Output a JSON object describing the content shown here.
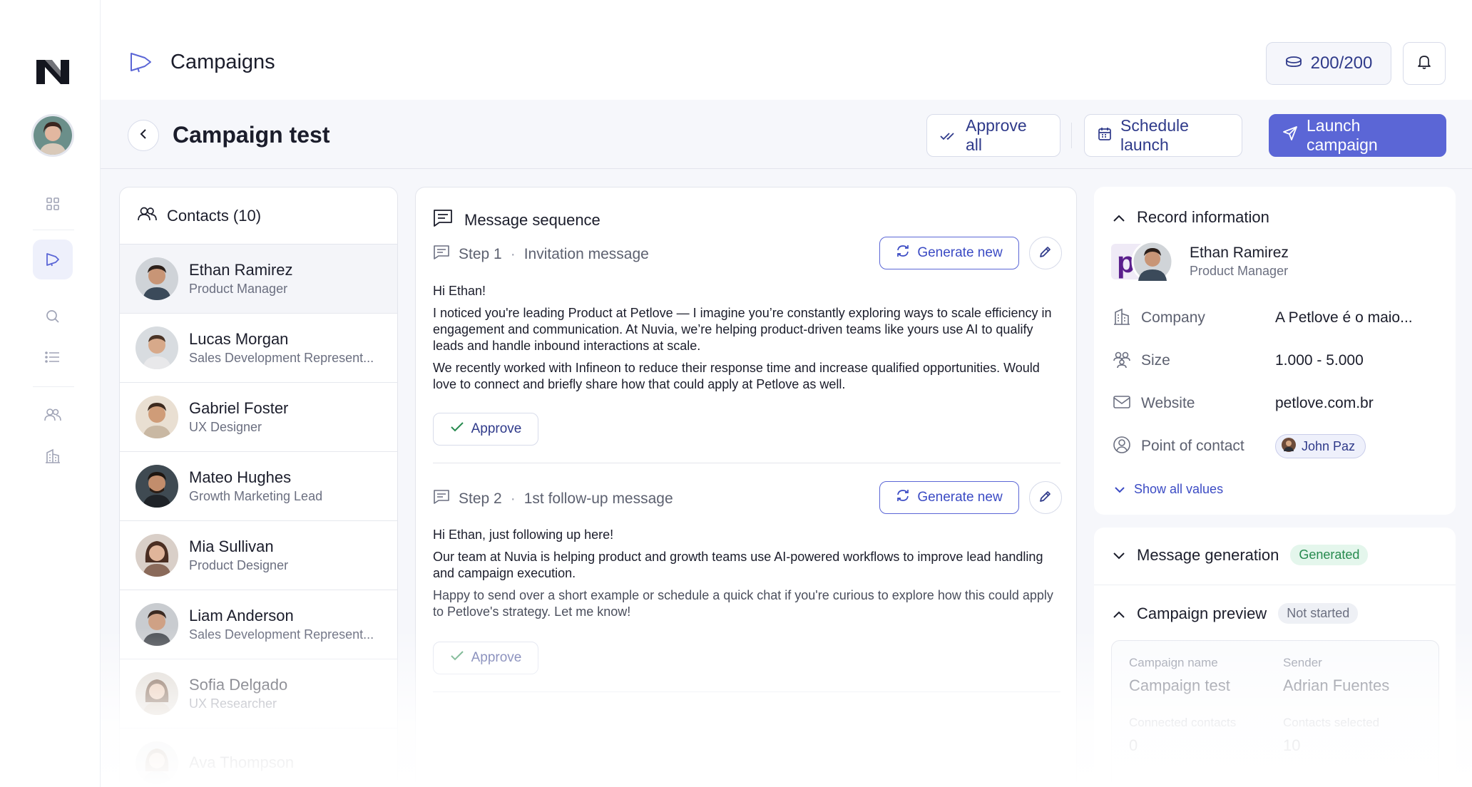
{
  "header": {
    "section_title": "Campaigns",
    "credits": "200/200",
    "page_title": "Campaign test",
    "approve_all": "Approve all",
    "schedule_launch": "Schedule launch",
    "launch_campaign": "Launch campaign"
  },
  "contacts": {
    "title": "Contacts (10)",
    "items": [
      {
        "name": "Ethan Ramirez",
        "role": "Product Manager"
      },
      {
        "name": "Lucas Morgan",
        "role": "Sales Development Represent..."
      },
      {
        "name": "Gabriel Foster",
        "role": "UX Designer"
      },
      {
        "name": "Mateo Hughes",
        "role": "Growth Marketing Lead"
      },
      {
        "name": "Mia Sullivan",
        "role": "Product Designer"
      },
      {
        "name": "Liam Anderson",
        "role": "Sales Development Represent..."
      },
      {
        "name": "Sofia Delgado",
        "role": "UX Researcher"
      },
      {
        "name": "Ava Thompson",
        "role": ""
      }
    ]
  },
  "messages": {
    "title": "Message sequence",
    "steps": [
      {
        "step": "Step 1",
        "name": "Invitation message",
        "generate": "Generate new",
        "approve": "Approve",
        "paragraphs": [
          "Hi Ethan!",
          "I noticed you're leading Product at Petlove — I imagine you’re constantly exploring ways to scale efficiency in engagement and communication. At Nuvia, we’re helping product-driven teams like yours use AI to qualify leads and handle inbound interactions at scale.",
          "We recently worked with Infineon to reduce their response time and increase qualified opportunities. Would love to connect and briefly share how that could apply at Petlove as well."
        ]
      },
      {
        "step": "Step 2",
        "name": "1st follow-up message",
        "generate": "Generate new",
        "approve": "Approve",
        "paragraphs": [
          "Hi Ethan, just following up here!",
          "Our team at Nuvia is helping product and growth teams use AI-powered workflows to improve lead handling and campaign execution.",
          "Happy to send over a short example or schedule a quick chat if you're curious to explore how this could apply to Petlove's strategy. Let me know!"
        ]
      }
    ]
  },
  "record": {
    "title": "Record information",
    "name": "Ethan Ramirez",
    "role": "Product Manager",
    "fields": [
      {
        "label": "Company",
        "value": "A Petlove é o maio..."
      },
      {
        "label": "Size",
        "value": "1.000 - 5.000"
      },
      {
        "label": "Website",
        "value": "petlove.com.br"
      },
      {
        "label": "Point of contact",
        "value": "John Paz"
      }
    ],
    "show_all": "Show all values"
  },
  "generation": {
    "title": "Message generation",
    "status": "Generated",
    "preview_title": "Campaign preview",
    "preview_status": "Not started",
    "preview": {
      "campaign_name_label": "Campaign name",
      "campaign_name": "Campaign test",
      "sender_label": "Sender",
      "sender": "Adrian Fuentes",
      "connected_label": "Connected contacts",
      "connected": "0",
      "selected_label": "Contacts selected",
      "selected": "10"
    }
  },
  "colors": {
    "primary": "#5b66d6",
    "accent_text": "#2f3a8a",
    "success": "#268a4e",
    "background": "#f6f7fb"
  },
  "icons": [
    "logo",
    "avatar",
    "grid-icon",
    "megaphone-icon",
    "search-icon",
    "list-icon",
    "users-icon",
    "building-icon",
    "coins-icon",
    "bell-icon",
    "chevron-left-icon",
    "double-check-icon",
    "calendar-icon",
    "send-icon",
    "message-icon",
    "refresh-icon",
    "pencil-icon",
    "check-icon",
    "chevron-up-icon",
    "chevron-down-icon",
    "mail-icon",
    "user-circle-icon"
  ]
}
